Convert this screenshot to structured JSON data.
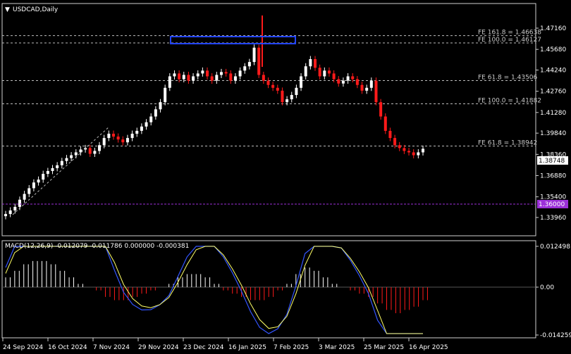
{
  "main": {
    "symbol_label": "USDCAD,Daily",
    "price_ticks": [
      "1.47160",
      "1.45680",
      "1.44240",
      "1.42760",
      "1.41280",
      "1.39840",
      "1.38360",
      "1.36880",
      "1.35400",
      "1.33960"
    ],
    "current_price": "1.38748",
    "level_1_3600": "1.36000",
    "fe_levels": [
      {
        "label": "FE 161.8 = 1.46638",
        "price": 1.46638
      },
      {
        "label": "FE 100.0 = 1.46127",
        "price": 1.46127
      },
      {
        "label": "FE 61.8 = 1.43506",
        "price": 1.43506
      },
      {
        "label": "FE 100.0 = 1.41882",
        "price": 1.41882
      },
      {
        "label": "FE 61.8 = 1.38942",
        "price": 1.38942
      }
    ]
  },
  "macd": {
    "label": "MACD(12,26,9) -0.012079 -0.011786 0.000000 -0.000381",
    "ticks": [
      "0.012498",
      "0.00",
      "-0.014259"
    ]
  },
  "time_axis": [
    "24 Sep 2024",
    "16 Oct 2024",
    "7 Nov 2024",
    "29 Nov 2024",
    "23 Dec 2024",
    "16 Jan 2025",
    "7 Feb 2025",
    "3 Mar 2025",
    "25 Mar 2025",
    "16 Apr 2025"
  ],
  "colors": {
    "bull": "#ffffff",
    "bear": "#ff1a1a",
    "signal": "#ffff66",
    "macd_line": "#3355ff",
    "level_purple": "#9b30d9",
    "box": "#2244ff"
  },
  "chart_data": {
    "type": "candlestick",
    "price_axis": {
      "min": 1.3396,
      "max": 1.4716
    },
    "closes": [
      1.342,
      1.3445,
      1.347,
      1.352,
      1.356,
      1.36,
      1.364,
      1.366,
      1.37,
      1.372,
      1.374,
      1.376,
      1.379,
      1.381,
      1.383,
      1.385,
      1.387,
      1.388,
      1.384,
      1.386,
      1.39,
      1.395,
      1.398,
      1.396,
      1.394,
      1.392,
      1.395,
      1.398,
      1.4,
      1.403,
      1.406,
      1.41,
      1.415,
      1.42,
      1.43,
      1.438,
      1.44,
      1.436,
      1.439,
      1.435,
      1.438,
      1.44,
      1.442,
      1.438,
      1.435,
      1.439,
      1.441,
      1.44,
      1.435,
      1.438,
      1.442,
      1.445,
      1.448,
      1.458,
      1.439,
      1.435,
      1.432,
      1.43,
      1.428,
      1.42,
      1.422,
      1.425,
      1.43,
      1.438,
      1.445,
      1.45,
      1.444,
      1.438,
      1.442,
      1.44,
      1.436,
      1.433,
      1.435,
      1.438,
      1.436,
      1.432,
      1.428,
      1.43,
      1.435,
      1.42,
      1.41,
      1.4,
      1.395,
      1.39,
      1.388,
      1.386,
      1.385,
      1.383,
      1.385,
      1.3875
    ],
    "macd_histogram": [
      0.003,
      0.005,
      0.007,
      0.008,
      0.008,
      0.007,
      0.005,
      0.003,
      0.001,
      0.0,
      -0.001,
      -0.003,
      -0.004,
      -0.004,
      -0.003,
      -0.002,
      -0.001,
      0.0,
      0.001,
      0.003,
      0.004,
      0.004,
      0.003,
      0.001,
      -0.001,
      -0.002,
      -0.003,
      -0.004,
      -0.004,
      -0.003,
      -0.001,
      0.001,
      0.004,
      0.006,
      0.005,
      0.003,
      0.001,
      0.0,
      -0.001,
      -0.002,
      -0.003,
      -0.005,
      -0.007,
      -0.008,
      -0.007,
      -0.006,
      -0.004
    ]
  }
}
